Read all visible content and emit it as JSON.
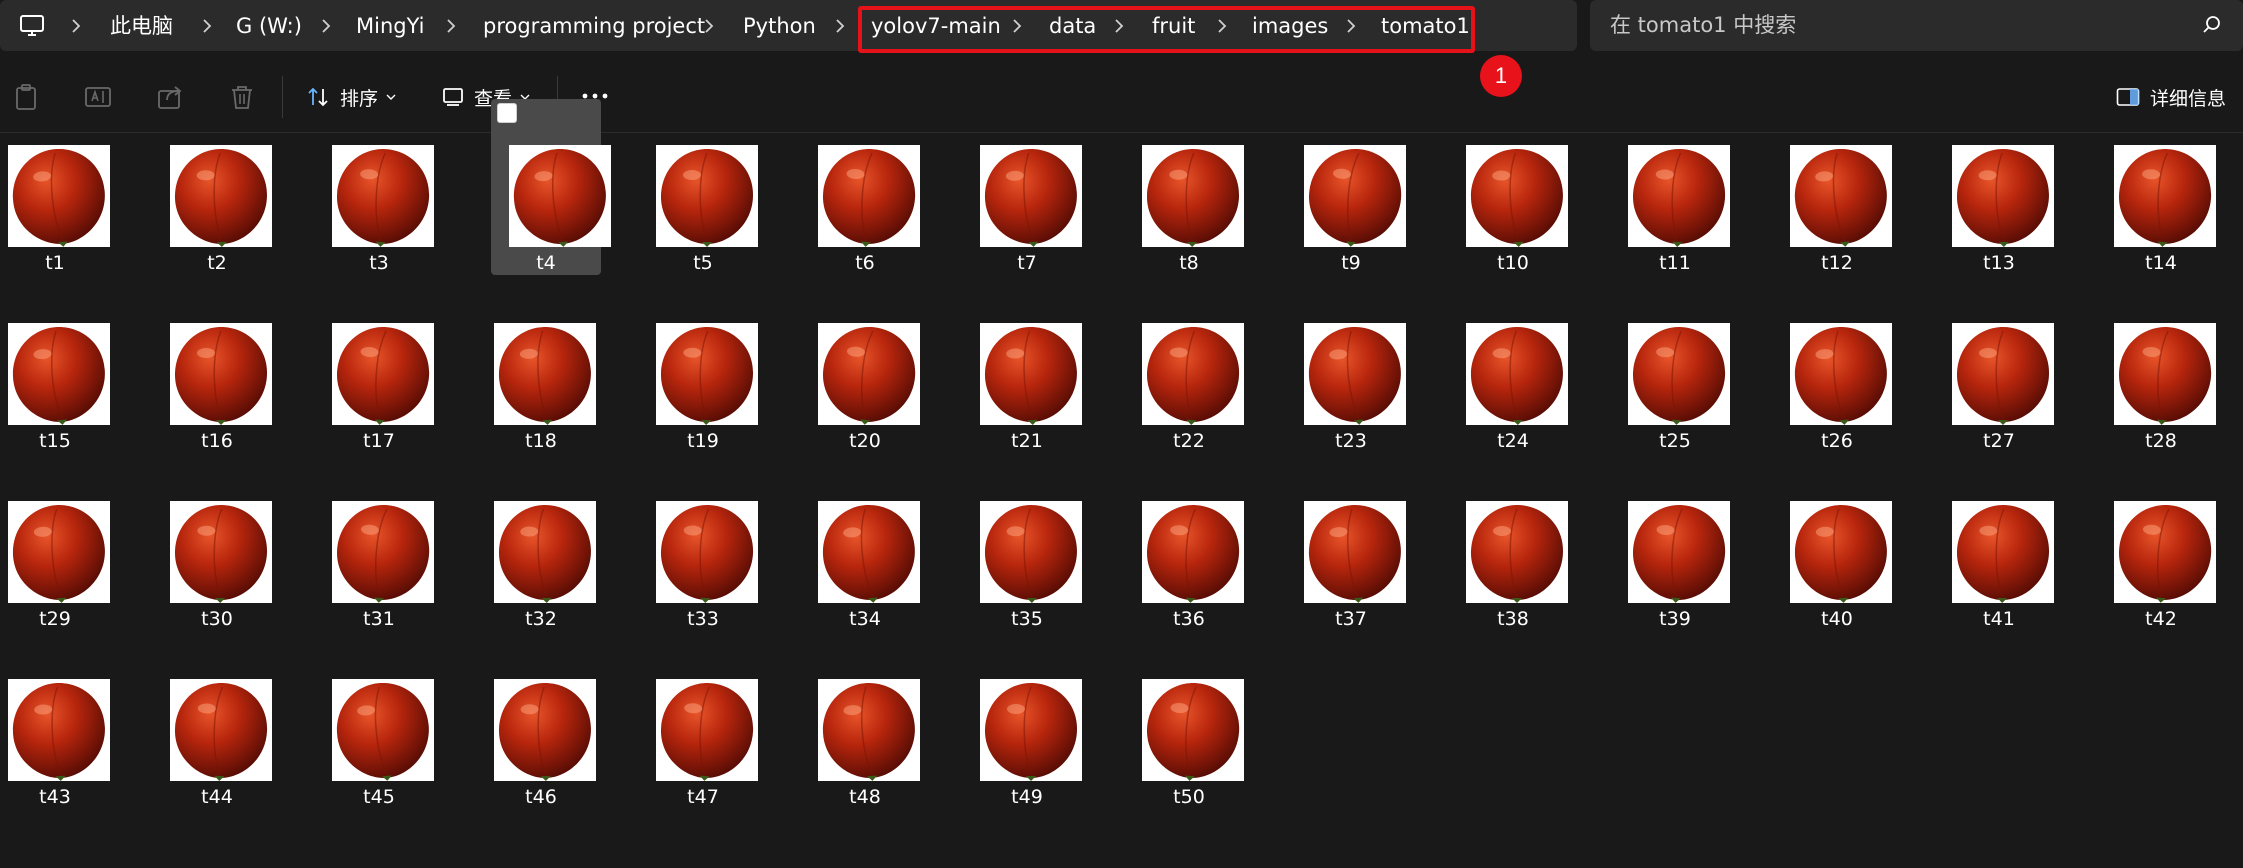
{
  "address_bar": {
    "breadcrumbs": [
      "此电脑",
      "G (W:)",
      "MingYi",
      "programming project",
      "Python",
      "yolov7-main",
      "data",
      "fruit",
      "images",
      "tomato1"
    ]
  },
  "search": {
    "placeholder": "在 tomato1 中搜索"
  },
  "annotation": {
    "step_number": "1",
    "highlight_color": "#e5121a"
  },
  "toolbar": {
    "sort_label": "排序",
    "view_label": "查看",
    "details_label": "详细信息"
  },
  "files": {
    "selected": "t4",
    "thumbnail_subject": "tomato",
    "items": [
      "t1",
      "t2",
      "t3",
      "t4",
      "t5",
      "t6",
      "t7",
      "t8",
      "t9",
      "t10",
      "t11",
      "t12",
      "t13",
      "t14",
      "t15",
      "t16",
      "t17",
      "t18",
      "t19",
      "t20",
      "t21",
      "t22",
      "t23",
      "t24",
      "t25",
      "t26",
      "t27",
      "t28",
      "t29",
      "t30",
      "t31",
      "t32",
      "t33",
      "t34",
      "t35",
      "t36",
      "t37",
      "t38",
      "t39",
      "t40",
      "t41",
      "t42",
      "t43",
      "t44",
      "t45",
      "t46",
      "t47",
      "t48",
      "t49",
      "t50"
    ]
  },
  "colors": {
    "background": "#191919",
    "bar": "#2b2b2b",
    "tomato": "#b8260d",
    "accent": "#e8121a"
  }
}
